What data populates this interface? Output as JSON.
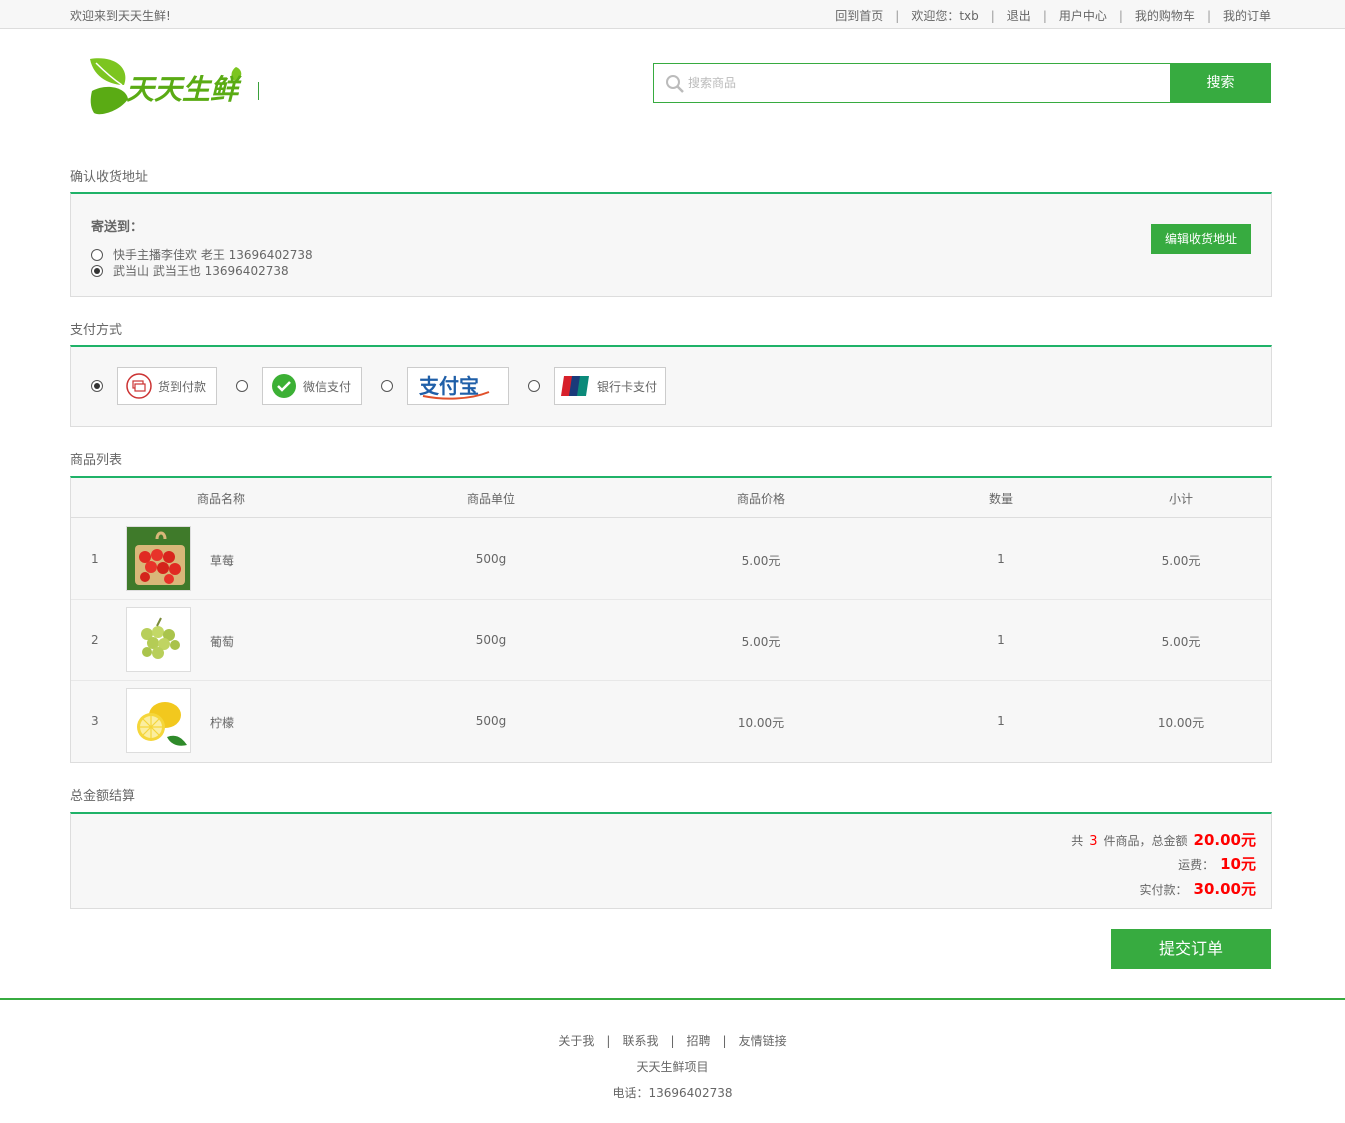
{
  "topbar": {
    "welcome": "欢迎来到天天生鲜!",
    "nav": [
      "回到首页",
      "欢迎您：txb",
      "退出",
      "用户中心",
      "我的购物车",
      "我的订单"
    ]
  },
  "header": {
    "logo_text": "天天生鲜",
    "search_placeholder": "搜索商品",
    "search_button": "搜索"
  },
  "address": {
    "section_title": "确认收货地址",
    "label": "寄送到：",
    "items": [
      {
        "text": "快手主播李佳欢 老王 13696402738",
        "selected": false
      },
      {
        "text": "武当山 武当王也 13696402738",
        "selected": true
      }
    ],
    "edit_button": "编辑收货地址"
  },
  "payment": {
    "section_title": "支付方式",
    "options": [
      {
        "label": "货到付款",
        "icon": "cash-on-delivery-icon",
        "selected": true
      },
      {
        "label": "微信支付",
        "icon": "wechat-pay-icon",
        "selected": false
      },
      {
        "label": "支付宝",
        "icon": "alipay-logo",
        "selected": false
      },
      {
        "label": "银行卡支付",
        "icon": "unionpay-icon",
        "selected": false
      }
    ]
  },
  "goods": {
    "section_title": "商品列表",
    "columns": [
      "商品名称",
      "商品单位",
      "商品价格",
      "数量",
      "小计"
    ],
    "rows": [
      {
        "index": "1",
        "name": "草莓",
        "unit": "500g",
        "price": "5.00元",
        "qty": "1",
        "subtotal": "5.00元",
        "image": "strawberry-image"
      },
      {
        "index": "2",
        "name": "葡萄",
        "unit": "500g",
        "price": "5.00元",
        "qty": "1",
        "subtotal": "5.00元",
        "image": "grape-image"
      },
      {
        "index": "3",
        "name": "柠檬",
        "unit": "500g",
        "price": "10.00元",
        "qty": "1",
        "subtotal": "10.00元",
        "image": "lemon-image"
      }
    ]
  },
  "summary": {
    "section_title": "总金额结算",
    "count_prefix": "共",
    "count": "3",
    "count_suffix": "件商品，总金额",
    "total": "20.00元",
    "shipping_label": "运费：",
    "shipping": "10元",
    "pay_label": "实付款：",
    "pay_total": "30.00元"
  },
  "submit_button": "提交订单",
  "footer": {
    "links": [
      "关于我",
      "联系我",
      "招聘",
      "友情链接"
    ],
    "project": "天天生鲜项目",
    "phone": "电话：13696402738"
  },
  "colors": {
    "brand_green": "#37ab40",
    "section_line": "#1fb268",
    "price_red": "#ff0000"
  }
}
